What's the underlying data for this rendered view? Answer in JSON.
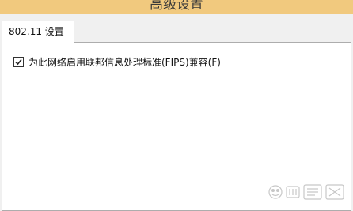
{
  "window": {
    "title": "高级设置"
  },
  "tabs": [
    {
      "label": "802.11 设置",
      "selected": true
    }
  ],
  "settings": {
    "fips_option": {
      "label": "为此网络启用联邦信息处理标准(FIPS)兼容(F)",
      "checked": true
    }
  },
  "watermark": {
    "text": "Baidu 经验"
  }
}
